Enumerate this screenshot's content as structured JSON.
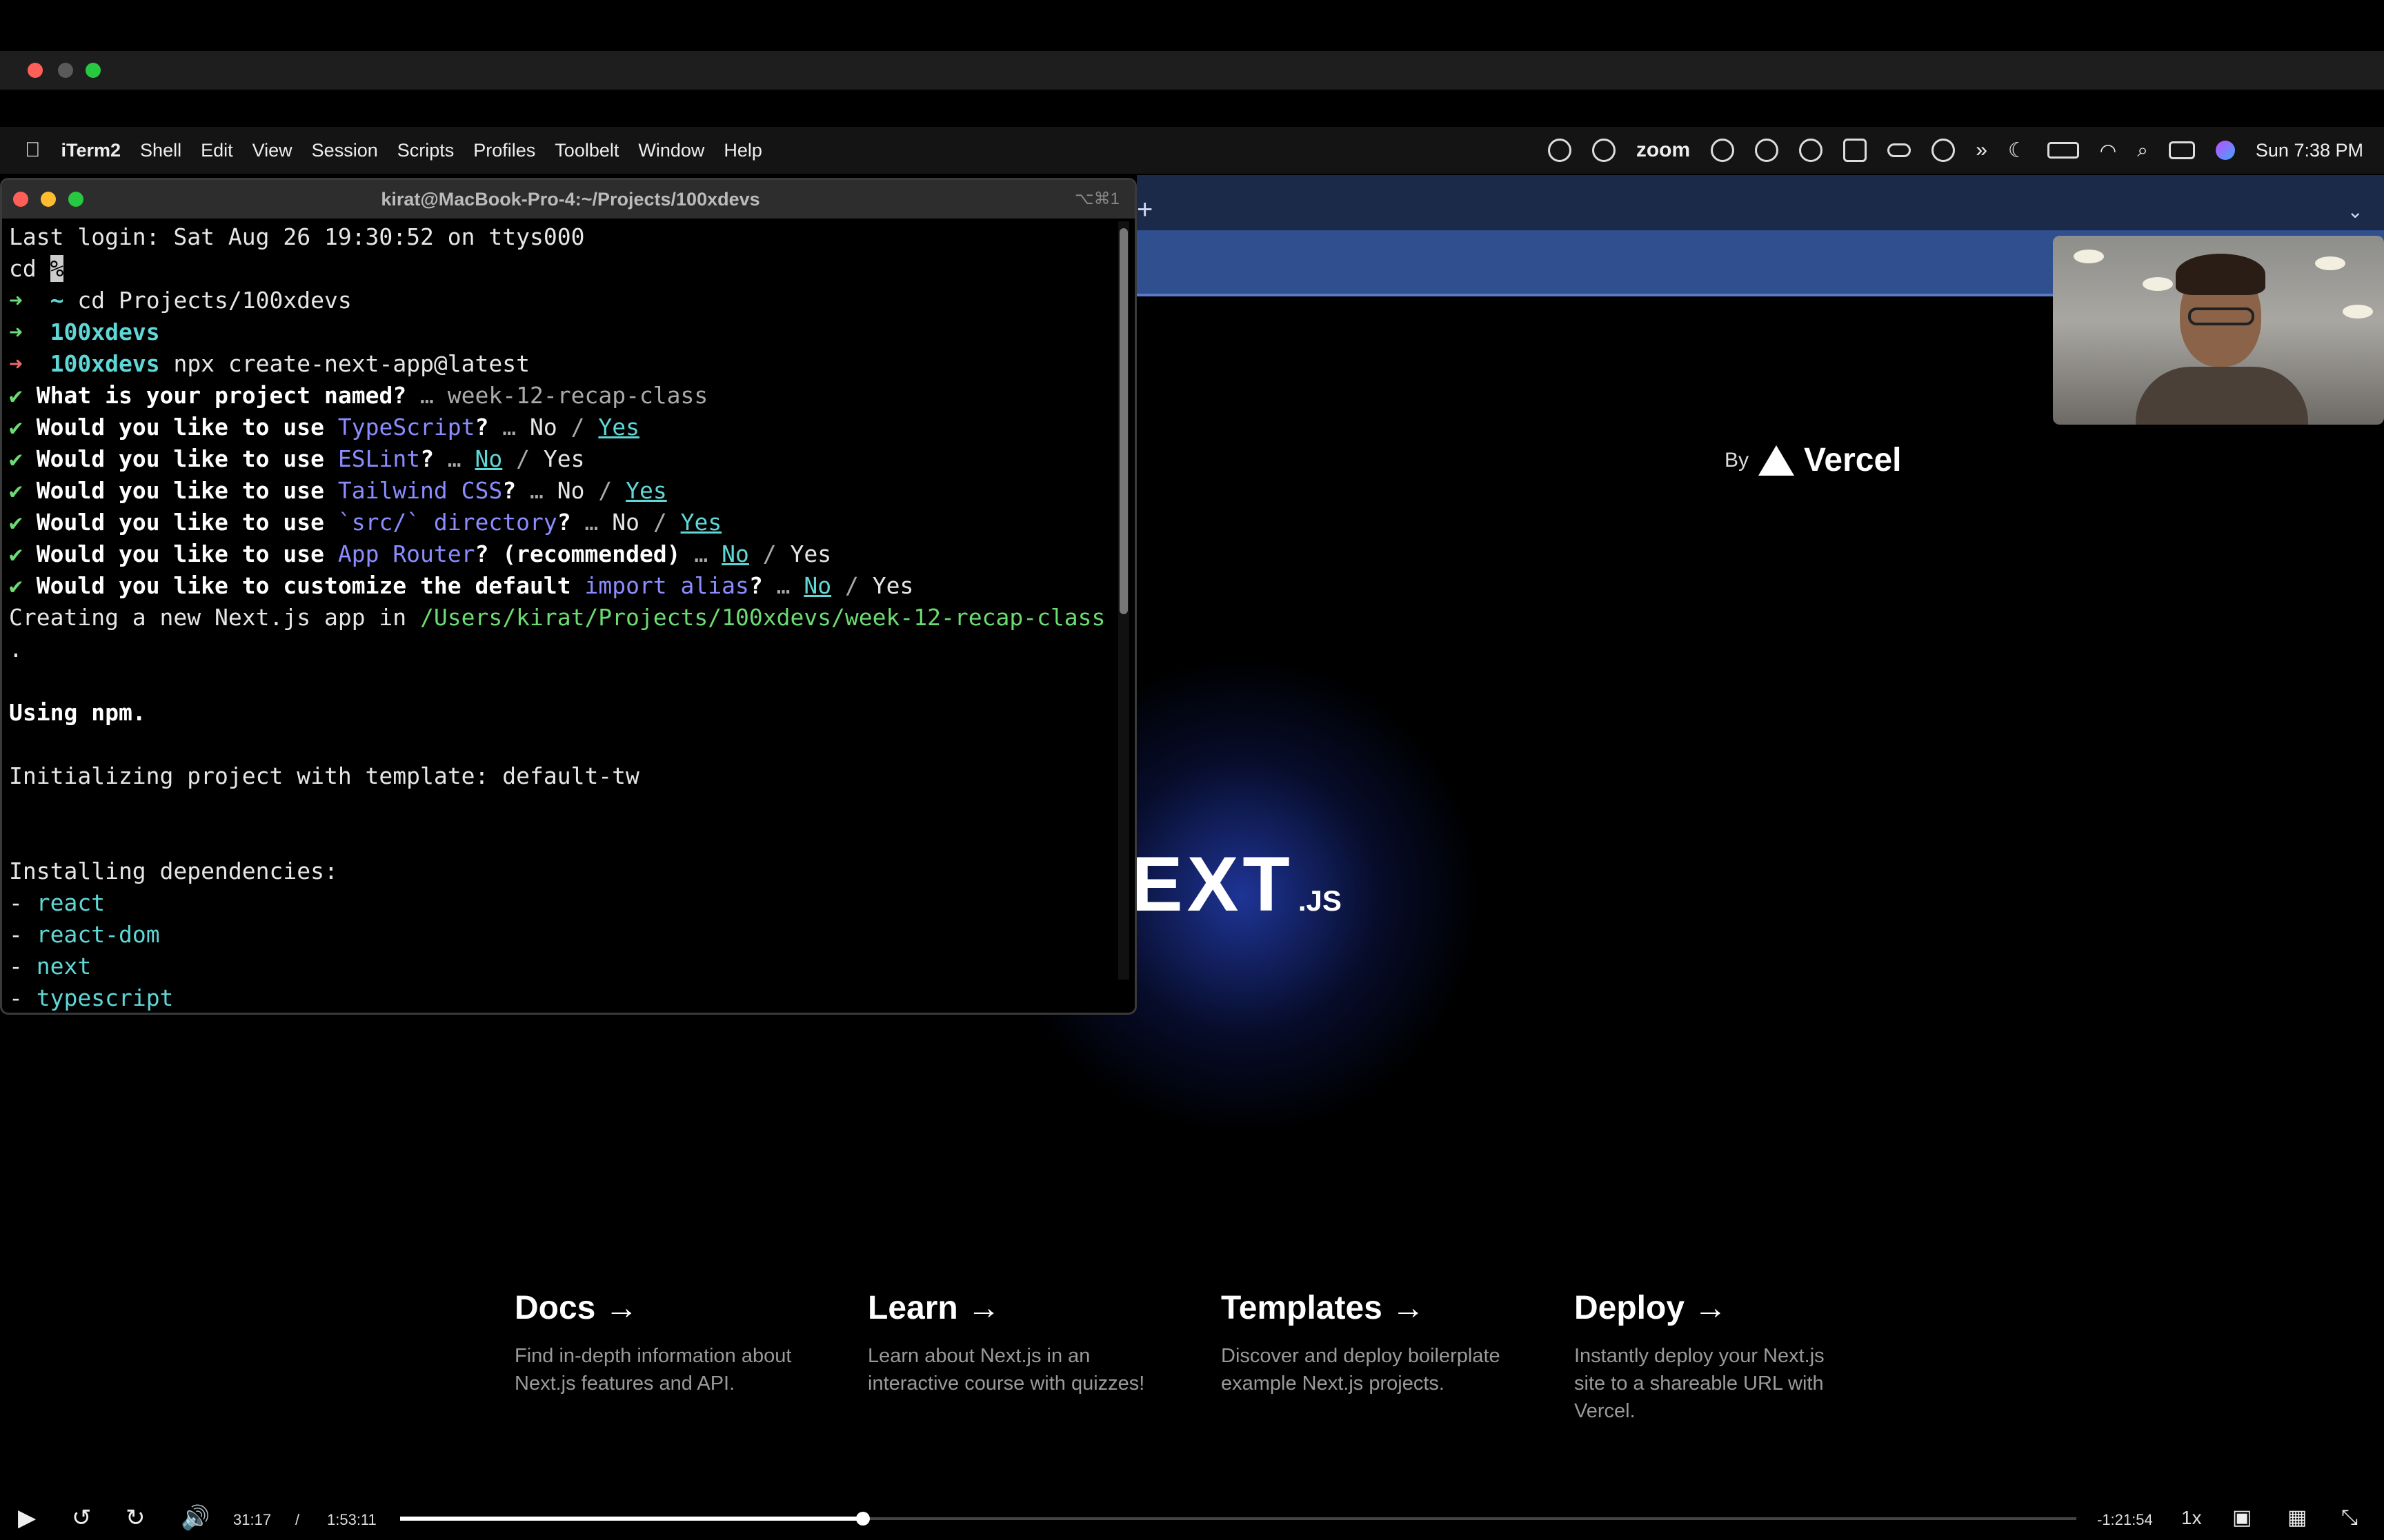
{
  "menubar": {
    "app_name": "iTerm2",
    "items": [
      "Shell",
      "Edit",
      "View",
      "Session",
      "Scripts",
      "Profiles",
      "Toolbelt",
      "Window",
      "Help"
    ],
    "zoom_label": "zoom",
    "clock": "Sun 7:38 PM"
  },
  "terminal": {
    "title": "kirat@MacBook-Pro-4:~/Projects/100xdevs",
    "shortcut": "⌥⌘1",
    "l1": "Last login: Sat Aug 26 19:30:52 on ttys000",
    "l2_cmd": "cd ",
    "l2_cursor": "%",
    "l3_arrow": "➜",
    "l3_dir": "~",
    "l3_cmd": " cd Projects/100xdevs",
    "l4_dir": "100xdevs",
    "l5_dir": "100xdevs",
    "l5_cmd": " npx create-next-app@latest",
    "check": "✔",
    "q1_pre": "What is your project named?",
    "q1_post": " … week-12-recap-class",
    "q_prefix": "Would you like to use ",
    "q2_hl": "TypeScript",
    "q3_hl": "ESLint",
    "q4_hl": "Tailwind CSS",
    "q5_hl": "`src/` directory",
    "q6_hl": "App Router",
    "q6_mid": "? (recommended)",
    "q7_pre": "Would you like to customize the default ",
    "q7_hl": "import alias",
    "qmark": "?",
    "ellipsis": " … ",
    "no": "No",
    "yes": "Yes",
    "slash": " / ",
    "creating_pre": "Creating a new Next.js app in ",
    "creating_path": "/Users/kirat/Projects/100xdevs/week-12-recap-class",
    "period": ".",
    "using_npm": "Using npm.",
    "init": "Initializing project with template: default-tw",
    "installing": "Installing dependencies:",
    "dash": "- ",
    "deps": [
      "react",
      "react-dom",
      "next",
      "typescript"
    ]
  },
  "nextpage": {
    "by": "By",
    "vercel": "Vercel",
    "logo_main": "EXT",
    "logo_sub": ".JS",
    "cards": [
      {
        "title": "Docs →",
        "desc": "Find in-depth information about Next.js features and API."
      },
      {
        "title": "Learn →",
        "desc": "Learn about Next.js in an interactive course with quizzes!"
      },
      {
        "title": "Templates →",
        "desc": "Discover and deploy boilerplate example Next.js projects."
      },
      {
        "title": "Deploy →",
        "desc": "Instantly deploy your Next.js site to a shareable URL with Vercel."
      }
    ]
  },
  "player": {
    "current_time": "31:17",
    "separator": "/",
    "duration": "1:53:11",
    "remaining": "-1:21:54",
    "speed": "1x",
    "progress": 0.276
  },
  "colors": {
    "traffic_red": "#ff5f57",
    "traffic_yellow": "#febc2e",
    "traffic_green": "#28c840",
    "traffic_gray": "#5a5a5a"
  }
}
